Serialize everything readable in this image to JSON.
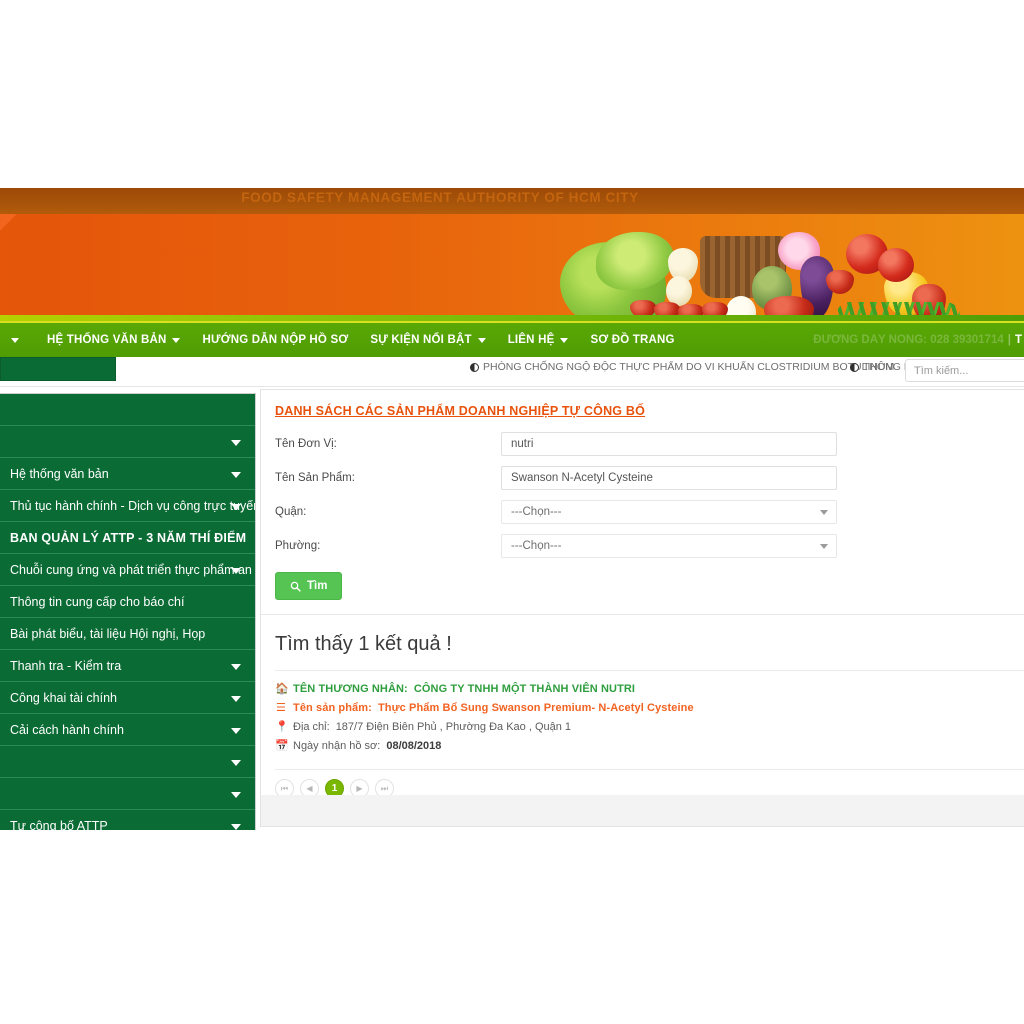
{
  "banner": {
    "title": "FOOD SAFETY MANAGEMENT AUTHORITY OF HCM CITY"
  },
  "navbar": {
    "items": [
      {
        "label": "",
        "caret": true
      },
      {
        "label": "HỆ THỐNG VĂN BẢN",
        "caret": true
      },
      {
        "label": "HƯỚNG DẪN NỘP HỒ SƠ",
        "caret": false
      },
      {
        "label": "SỰ KIỆN NỔI BẬT",
        "caret": true
      },
      {
        "label": "LIÊN HỆ",
        "caret": true
      },
      {
        "label": "SƠ ĐỒ TRANG",
        "caret": false
      }
    ],
    "hotline": "ĐƯỜNG DÂY NÓNG: 028 39301714",
    "hotline_sep": "|",
    "hotline_tail": "T"
  },
  "subbar": {
    "ticker1": "PHÒNG CHỐNG NGỘ ĐỘC THỰC PHẨM DO VI KHUẨN CLOSTRIDIUM BOTULINUM",
    "ticker2": "THÔNG B",
    "search_placeholder": "Tìm kiếm...",
    "search_value": ""
  },
  "sidebar": {
    "items": [
      {
        "label": "",
        "caret": false,
        "bold": false
      },
      {
        "label": "",
        "caret": true,
        "bold": false
      },
      {
        "label": "Hệ thống văn bản",
        "caret": true,
        "bold": false
      },
      {
        "label": "Thủ tục hành chính - Dịch vụ công trực tuyến",
        "caret": true,
        "bold": false
      },
      {
        "label": "BAN QUẢN LÝ ATTP - 3 NĂM THÍ ĐIỂM",
        "caret": false,
        "bold": true
      },
      {
        "label": "Chuỗi cung ứng và phát triển thực phẩm an toàn",
        "caret": true,
        "bold": false
      },
      {
        "label": "Thông tin cung cấp cho báo chí",
        "caret": false,
        "bold": false
      },
      {
        "label": "Bài phát biểu, tài liệu Hội nghị, Họp",
        "caret": false,
        "bold": false
      },
      {
        "label": "Thanh tra - Kiểm tra",
        "caret": true,
        "bold": false
      },
      {
        "label": "Công khai tài chính",
        "caret": true,
        "bold": false
      },
      {
        "label": "Cải cách hành chính",
        "caret": true,
        "bold": false
      },
      {
        "label": "",
        "caret": true,
        "bold": false
      },
      {
        "label": "",
        "caret": true,
        "bold": false
      },
      {
        "label": "Tự công bố ATTP",
        "caret": true,
        "bold": false
      }
    ]
  },
  "content": {
    "title": "DANH SÁCH CÁC SẢN PHẨM DOANH NGHIỆP TỰ CÔNG BỐ",
    "form": {
      "fields": [
        {
          "label": "Tên Đơn Vị:",
          "type": "text",
          "value": "nutri",
          "placeholder": ""
        },
        {
          "label": "Tên Sản Phẩm:",
          "type": "text",
          "value": "Swanson N-Acetyl Cysteine",
          "placeholder": ""
        },
        {
          "label": "Quận:",
          "type": "select",
          "value": "---Chọn---",
          "placeholder": ""
        },
        {
          "label": "Phường:",
          "type": "select",
          "value": "---Chọn---",
          "placeholder": ""
        }
      ],
      "submit_label": "Tìm",
      "submit_icon": "search-icon"
    },
    "results": {
      "heading": "Tìm thấy 1 kết quả !",
      "items": [
        {
          "merchant_label": "TÊN THƯƠNG NHÂN:",
          "merchant_value": "CÔNG TY TNHH MỘT THÀNH VIÊN NUTRI",
          "product_label": "Tên sản phẩm:",
          "product_value": "Thực Phẩm Bổ Sung Swanson Premium- N-Acetyl Cysteine",
          "address_label": "Địa chỉ:",
          "address_value": "187/7 Điện Biên Phủ , Phường Đa Kao , Quận 1",
          "date_label": "Ngày nhận hồ sơ:",
          "date_value": "08/08/2018"
        }
      ],
      "pagination": {
        "first": "⏮",
        "prev": "◀",
        "next": "▶",
        "last": "⏭",
        "pages": [
          "1"
        ],
        "current": "1"
      }
    }
  }
}
